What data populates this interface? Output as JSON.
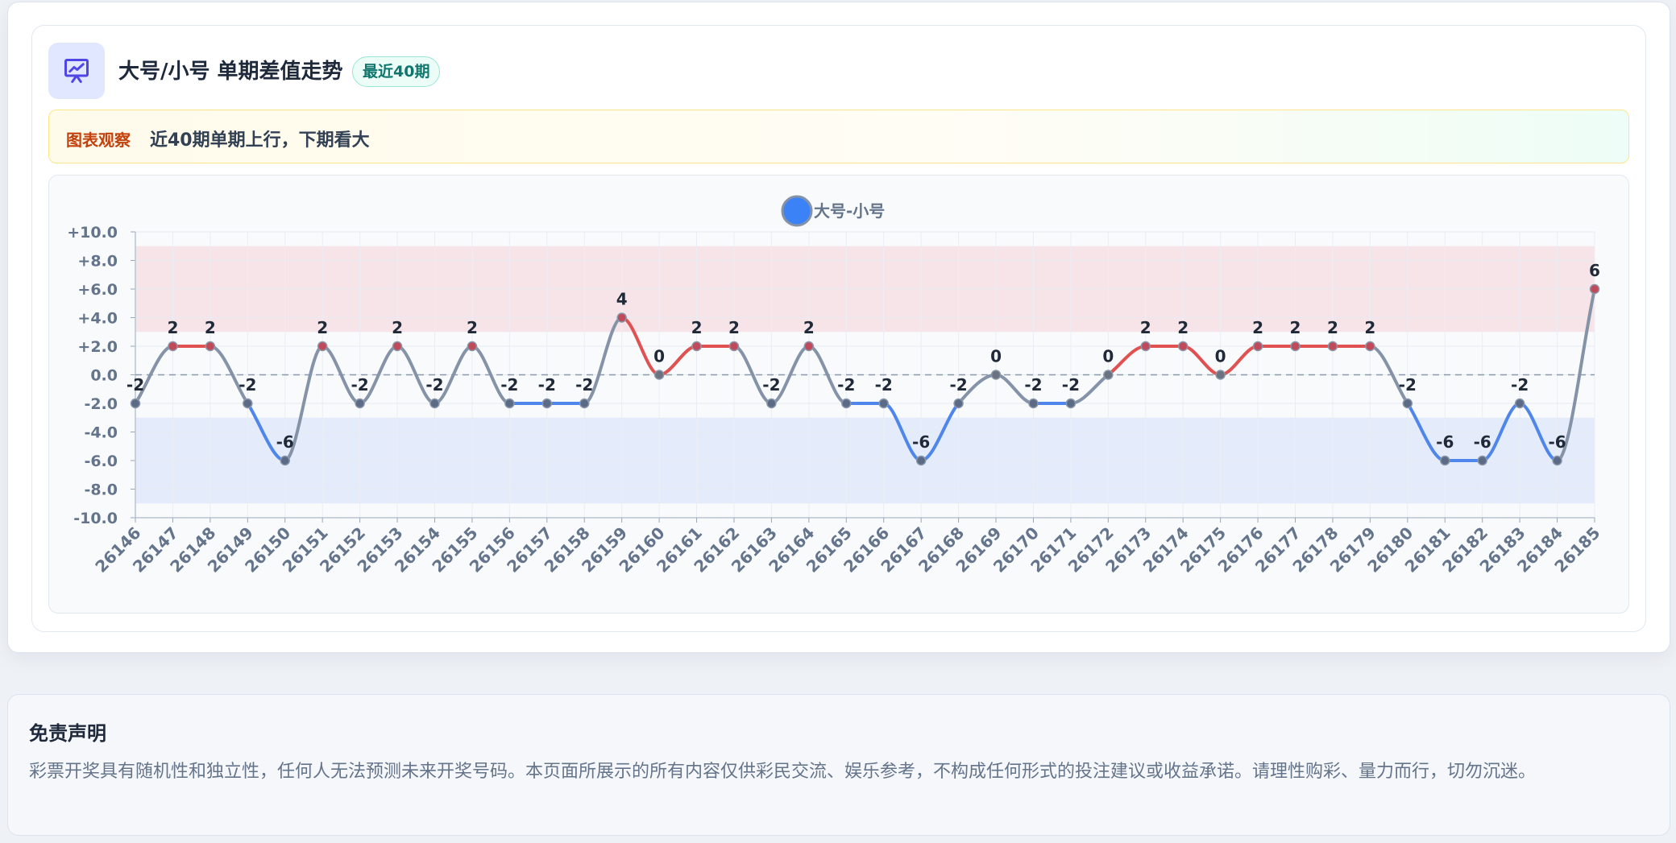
{
  "header": {
    "title": "大号/小号 单期差值走势",
    "badge": "最近40期"
  },
  "note": {
    "label": "图表观察",
    "text": "近40期单期上行，下期看大"
  },
  "colors": {
    "up": "#e05252",
    "down": "#4f86ec",
    "neutral": "#8593a8",
    "legend_marker": "#3b82f6",
    "up_band": "#f7e4e8",
    "down_band": "#e4ecfb"
  },
  "chart_data": {
    "type": "line",
    "title": "",
    "xlabel": "",
    "ylabel": "",
    "ylim": [
      -10,
      10
    ],
    "yticks": [
      10,
      8,
      6,
      4,
      2,
      0,
      -2,
      -4,
      -6,
      -8,
      -10
    ],
    "ytick_labels": [
      "+10.0",
      "+8.0",
      "+6.0",
      "+4.0",
      "+2.0",
      "0.0",
      "-2.0",
      "-4.0",
      "-6.0",
      "-8.0",
      "-10.0"
    ],
    "bands": [
      {
        "from": 3,
        "to": 9,
        "color": "up_band"
      },
      {
        "from": -9,
        "to": -3,
        "color": "down_band"
      }
    ],
    "reference_line": 0,
    "legend": {
      "position": "top-center"
    },
    "grid": true,
    "categories": [
      "26146",
      "26147",
      "26148",
      "26149",
      "26150",
      "26151",
      "26152",
      "26153",
      "26154",
      "26155",
      "26156",
      "26157",
      "26158",
      "26159",
      "26160",
      "26161",
      "26162",
      "26163",
      "26164",
      "26165",
      "26166",
      "26167",
      "26168",
      "26169",
      "26170",
      "26171",
      "26172",
      "26173",
      "26174",
      "26175",
      "26176",
      "26177",
      "26178",
      "26179",
      "26180",
      "26181",
      "26182",
      "26183",
      "26184",
      "26185"
    ],
    "series": [
      {
        "name": "大号-小号",
        "values": [
          -2,
          2,
          2,
          -2,
          -6,
          2,
          -2,
          2,
          -2,
          2,
          -2,
          -2,
          -2,
          4,
          0,
          2,
          2,
          -2,
          2,
          -2,
          -2,
          -6,
          -2,
          0,
          -2,
          -2,
          0,
          2,
          2,
          0,
          2,
          2,
          2,
          2,
          -2,
          -6,
          -6,
          -2,
          -6,
          6
        ]
      }
    ]
  },
  "disclaimer": {
    "title": "免责声明",
    "text": "彩票开奖具有随机性和独立性，任何人无法预测未来开奖号码。本页面所展示的所有内容仅供彩民交流、娱乐参考，不构成任何形式的投注建议或收益承诺。请理性购彩、量力而行，切勿沉迷。"
  }
}
